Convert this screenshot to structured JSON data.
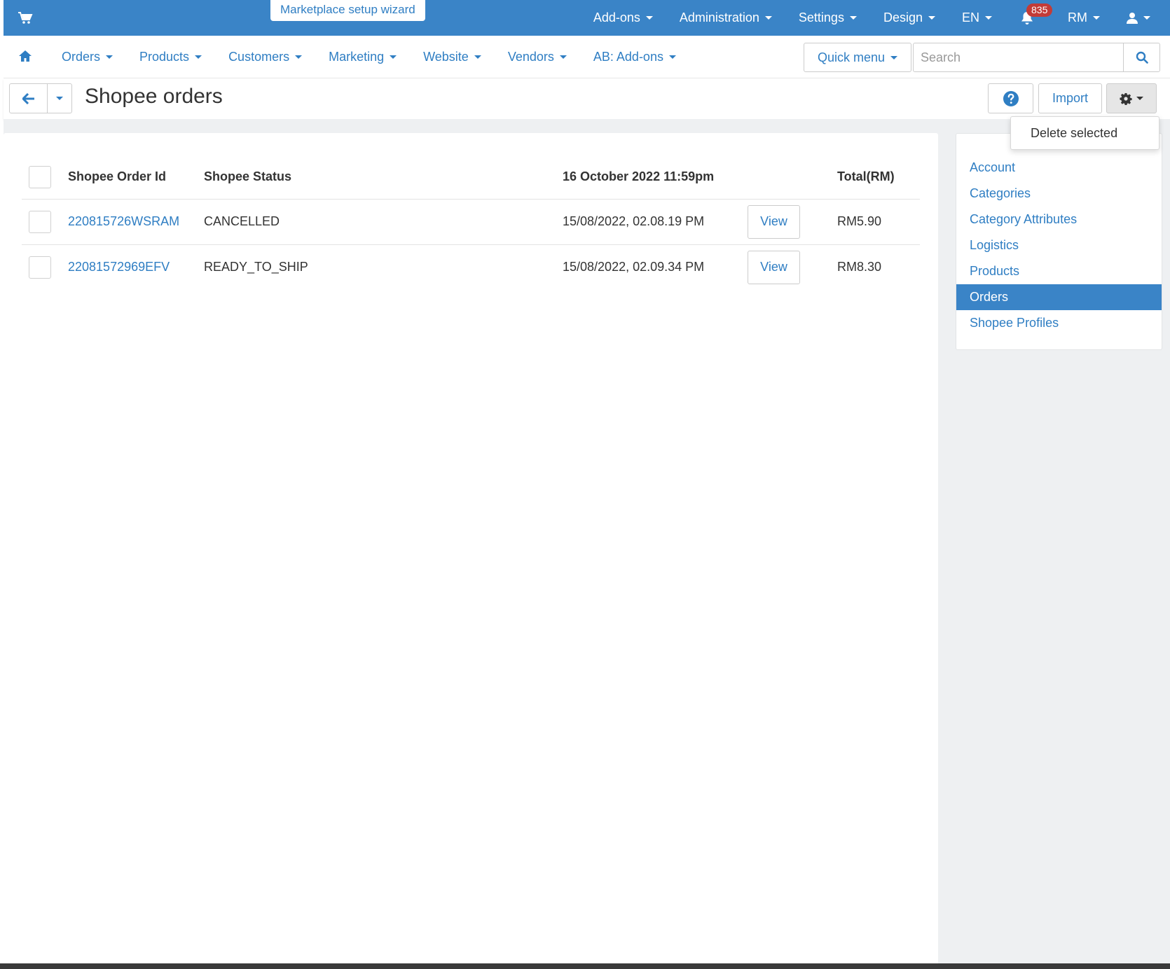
{
  "topbar": {
    "wizard_label": "Marketplace setup wizard",
    "items": [
      {
        "label": "Add-ons"
      },
      {
        "label": "Administration"
      },
      {
        "label": "Settings"
      },
      {
        "label": "Design"
      },
      {
        "label": "EN"
      }
    ],
    "notifications_count": "835",
    "currency_label": "RM",
    "icons": {
      "cart": "cart-icon",
      "bell": "bell-icon",
      "user": "user-icon"
    }
  },
  "subnav": {
    "items": [
      {
        "label": "Orders"
      },
      {
        "label": "Products"
      },
      {
        "label": "Customers"
      },
      {
        "label": "Marketing"
      },
      {
        "label": "Website"
      },
      {
        "label": "Vendors"
      },
      {
        "label": "AB: Add-ons"
      }
    ],
    "quick_menu_label": "Quick menu",
    "search": {
      "placeholder": "Search",
      "value": ""
    }
  },
  "titlebar": {
    "title": "Shopee orders",
    "import_label": "Import"
  },
  "dropdown": {
    "delete_selected_label": "Delete selected"
  },
  "table": {
    "headers": [
      "Shopee Order Id",
      "Shopee Status",
      "16 October 2022 11:59pm",
      "",
      "Total(RM)"
    ],
    "rows": [
      {
        "order_id": "220815726WSRAM",
        "status": "CANCELLED",
        "date": "15/08/2022, 02.08.19 PM",
        "view_label": "View",
        "total": "RM5.90"
      },
      {
        "order_id": "22081572969EFV",
        "status": "READY_TO_SHIP",
        "date": "15/08/2022, 02.09.34 PM",
        "view_label": "View",
        "total": "RM8.30"
      }
    ]
  },
  "sidebar": {
    "items": [
      {
        "label": "Account"
      },
      {
        "label": "Categories"
      },
      {
        "label": "Category Attributes"
      },
      {
        "label": "Logistics"
      },
      {
        "label": "Products"
      },
      {
        "label": "Orders"
      },
      {
        "label": "Shopee Profiles"
      }
    ],
    "active": "Orders"
  },
  "colors": {
    "brand_blue": "#3a84c7",
    "link_blue": "#2f7ec3",
    "badge_red": "#c33b37",
    "page_bg": "#eef0f2"
  }
}
